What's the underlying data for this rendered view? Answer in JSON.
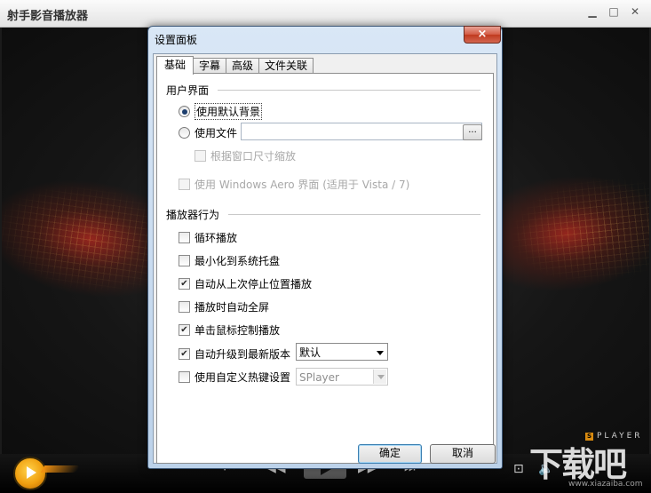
{
  "player": {
    "title": "射手影音播放器",
    "brand": "PLAYER",
    "brand_badge": "S",
    "watermark": "下载吧",
    "watermark_sub": "www.xiazaiba.com"
  },
  "dialog": {
    "title": "设置面板",
    "close_label": "×",
    "tabs": [
      {
        "label": "基础",
        "active": true
      },
      {
        "label": "字幕",
        "active": false
      },
      {
        "label": "高级",
        "active": false
      },
      {
        "label": "文件关联",
        "active": false
      }
    ],
    "ui_section": {
      "title": "用户界面",
      "default_bg_label": "使用默认背景",
      "default_bg_checked": true,
      "use_file_label": "使用文件",
      "use_file_checked": false,
      "file_value": "",
      "browse_label": "...",
      "scale_label": "根据窗口尺寸缩放",
      "scale_checked": false,
      "aero_label": "使用 Windows Aero 界面 (适用于 Vista / 7)",
      "aero_checked": false
    },
    "behavior_section": {
      "title": "播放器行为",
      "options": [
        {
          "label": "循环播放",
          "checked": false
        },
        {
          "label": "最小化到系统托盘",
          "checked": false
        },
        {
          "label": "自动从上次停止位置播放",
          "checked": true
        },
        {
          "label": "播放时自动全屏",
          "checked": false
        },
        {
          "label": "单击鼠标控制播放",
          "checked": true
        },
        {
          "label": "自动升级到最新版本",
          "checked": true
        },
        {
          "label": "使用自定义热键设置",
          "checked": false
        }
      ],
      "upgrade_select_value": "默认",
      "hotkey_select_value": "SPlayer"
    },
    "ok_label": "确定",
    "cancel_label": "取消"
  },
  "colors": {
    "dialog_frame": "#bcd2ea",
    "accent": "#3c7fb1",
    "logo": "#f0a010"
  }
}
